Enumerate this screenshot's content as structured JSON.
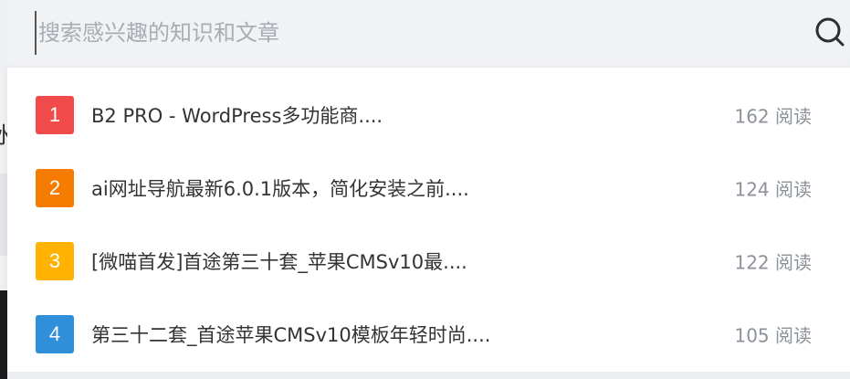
{
  "search": {
    "placeholder": "搜索感兴趣的知识和文章",
    "icon": "search-icon"
  },
  "background": {
    "partial_glyph": "水"
  },
  "hot_list": {
    "items": [
      {
        "rank": "1",
        "title": "B2 PRO - WordPress多功能商....",
        "reads": "162 阅读",
        "color": "#f04a4a"
      },
      {
        "rank": "2",
        "title": "ai网址导航最新6.0.1版本，简化安装之前....",
        "reads": "124 阅读",
        "color": "#f57c00"
      },
      {
        "rank": "3",
        "title": "[微喵首发]首途第三十套_苹果CMSv10最....",
        "reads": "122 阅读",
        "color": "#ffb300"
      },
      {
        "rank": "4",
        "title": "第三十二套_首途苹果CMSv10模板年轻时尚....",
        "reads": "105 阅读",
        "color": "#2f8fd8"
      }
    ]
  }
}
